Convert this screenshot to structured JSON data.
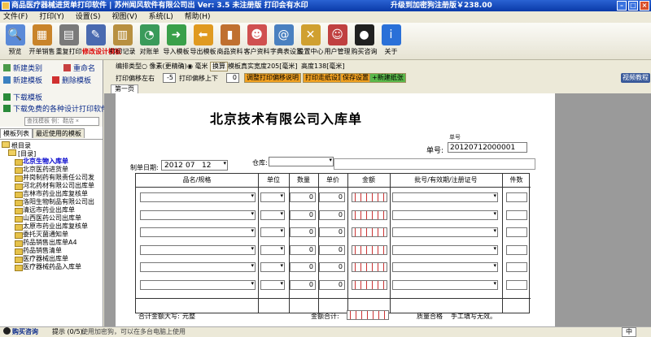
{
  "title": {
    "text": "商品医疗器械进货单打印软件 | 苏州闻风软件有限公司出  Ver: 3.5  未注册版  打印会有水印",
    "upgrade": "升级到加密狗注册版￥238.00"
  },
  "menu": [
    "文件(F)",
    "打印(Y)",
    "设置(S)",
    "视图(V)",
    "系统(L)",
    "帮助(H)"
  ],
  "toolbar": [
    {
      "label": "预览",
      "icon": "magnifier-icon",
      "color": "#5a8ad8",
      "glyph": "🔍"
    },
    {
      "label": "开单销售",
      "icon": "cash-register-icon",
      "color": "#c9842a",
      "glyph": "▦"
    },
    {
      "label": "重复打印",
      "icon": "printer-icon",
      "color": "#7a7a7a",
      "glyph": "▤"
    },
    {
      "label": "修改设计模板",
      "icon": "design-tools-icon",
      "color": "#4a6ab0",
      "glyph": "✎",
      "active": true
    },
    {
      "label": "打印记录",
      "icon": "clipboard-icon",
      "color": "#b89040",
      "glyph": "▥"
    },
    {
      "label": "对账单",
      "icon": "pie-chart-icon",
      "color": "#3a9a5a",
      "glyph": "◔"
    },
    {
      "label": "导入模板",
      "icon": "import-arrow-icon",
      "color": "#3aa04a",
      "glyph": "➜"
    },
    {
      "label": "导出模板",
      "icon": "export-arrow-icon",
      "color": "#e09a20",
      "glyph": "⬅"
    },
    {
      "label": "商品资料",
      "icon": "product-box-icon",
      "color": "#c07030",
      "glyph": "▮"
    },
    {
      "label": "客户资料",
      "icon": "customers-icon",
      "color": "#d05050",
      "glyph": "☻"
    },
    {
      "label": "字典表设置",
      "icon": "dictionary-icon",
      "color": "#4a80c0",
      "glyph": "@"
    },
    {
      "label": "设置中心",
      "icon": "tools-icon",
      "color": "#d0a030",
      "glyph": "✕"
    },
    {
      "label": "用户管理",
      "icon": "user-icon",
      "color": "#c04040",
      "glyph": "☺"
    },
    {
      "label": "购买咨询",
      "icon": "qq-penguin-icon",
      "color": "#202020",
      "glyph": "●"
    },
    {
      "label": "关于",
      "icon": "info-icon",
      "color": "#2a70d8",
      "glyph": "i"
    }
  ],
  "sidebar": {
    "actions": {
      "new_category": "新建类别",
      "rename": "重命名",
      "new_template": "新建模板",
      "delete_template": "删除模板",
      "download_template": "下载模板",
      "download_free": "下载免费的各种设计打印软件"
    },
    "search_placeholder": "查找模板 例：鞋店 ×",
    "tabs": [
      "模板列表",
      "最近使用的模板"
    ],
    "tree": {
      "root": "根目录",
      "folder": "[目录]",
      "items": [
        "北京生物入库单",
        "北京医药进货单",
        "井岗制药有限责任公司发",
        "河北药材有限公司出库单",
        "吉林市药业出库复核单",
        "洛阳生物制品有限公司出",
        "清远市药业出库单",
        "山西医药公司出库单",
        "太原市药业出库复核单",
        "委托灭菌通知单",
        "药品销售出库单A4",
        "药品销售清单",
        "医疗器械出库单",
        "医疗器械药品入库单"
      ],
      "selected_index": 0
    }
  },
  "options": {
    "type_label": "编排类型",
    "type_a": "像素(更精确)",
    "type_b": "毫米",
    "convert_btn": "换算",
    "paper_width_label": "模板真实宽度",
    "paper_width": "205[毫米]",
    "height_label": "高度138[毫米]",
    "offset_lr_label": "打印偏移左右",
    "offset_lr": "-5",
    "offset_ud_label": "打印偏移上下",
    "offset_ud": "0",
    "btn_adjust": "调整打印偏移说明",
    "btn_print_line": "打印走纸设置",
    "btn_save": "保存设置",
    "btn_new": "+新建纸张",
    "video_btn": "视频教程"
  },
  "page_tab": "第一页",
  "sheet": {
    "title": "北京技术有限公司入库单",
    "number_tag": "单号",
    "number_label": "单号:",
    "number_value": "20120712000001",
    "date_label": "制单日期:",
    "date_year": "2012",
    "date_month": "07",
    "date_day": "12",
    "warehouse_label": "仓库:",
    "headers": [
      "品名/规格",
      "单位",
      "数量",
      "单价",
      "金额",
      "批号/有效期/注册证号",
      "件数"
    ],
    "rows": [
      {
        "qty": "0",
        "price": "0"
      },
      {
        "qty": "0",
        "price": "0"
      },
      {
        "qty": "0",
        "price": "0"
      },
      {
        "qty": "0",
        "price": "0"
      },
      {
        "qty": "0",
        "price": "0"
      },
      {
        "qty": "0",
        "price": "0"
      }
    ],
    "total_caps_label": "合计金额大写:",
    "total_caps_value": "元整",
    "total_label": "金额合计:",
    "quality_label": "质量合格",
    "handwrite_label": "手工填写无效。"
  },
  "status": {
    "buy": "购买咨询",
    "tip": "提示 (0/5):",
    "message": "使用加密狗，可以在多台电脑上使用",
    "ime": "中"
  }
}
